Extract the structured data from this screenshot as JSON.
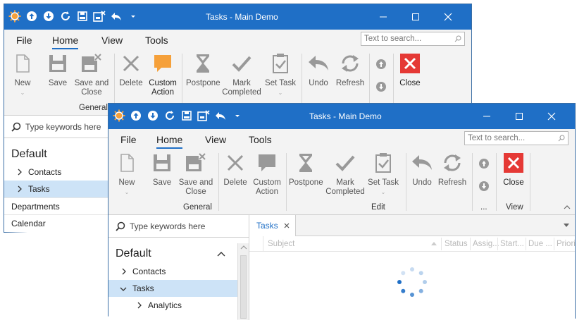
{
  "back_window": {
    "title": "Tasks - Main Demo",
    "tabs": [
      "File",
      "Home",
      "View",
      "Tools"
    ],
    "active_tab": "Home",
    "search_placeholder": "Text to search...",
    "ribbon": {
      "buttons": [
        "New",
        "Save",
        "Save and\nClose",
        "Delete",
        "Custom\nAction",
        "Postpone",
        "Mark\nCompleted",
        "Set Task",
        "Undo",
        "Refresh",
        "Close"
      ],
      "group_label": "General"
    },
    "nav": {
      "search_placeholder": "Type keywords here",
      "header": "Default",
      "items": [
        "Contacts",
        "Tasks",
        "Departments",
        "Calendar"
      ]
    }
  },
  "front_window": {
    "title": "Tasks - Main Demo",
    "tabs": [
      "File",
      "Home",
      "View",
      "Tools"
    ],
    "active_tab": "Home",
    "search_placeholder": "Text to search...",
    "ribbon": {
      "buttons": [
        "New",
        "Save",
        "Save and\nClose",
        "Delete",
        "Custom\nAction",
        "Postpone",
        "Mark\nCompleted",
        "Set Task",
        "Undo",
        "Refresh",
        "Close"
      ],
      "groups": [
        "General",
        "Edit",
        "...",
        "View"
      ]
    },
    "nav": {
      "search_placeholder": "Type keywords here",
      "header": "Default",
      "items": [
        "Contacts",
        "Tasks",
        "Analytics"
      ]
    },
    "doc_tab": "Tasks",
    "grid_columns": [
      "Subject",
      "Status",
      "Assig...",
      "Start...",
      "Due ...",
      "Priority"
    ]
  },
  "colors": {
    "titlebar": "#1f6fc6",
    "ribbon": "#f3f3f3",
    "selection": "#cde3f7",
    "close_red": "#e53935",
    "accent_orange": "#f5a03a"
  }
}
